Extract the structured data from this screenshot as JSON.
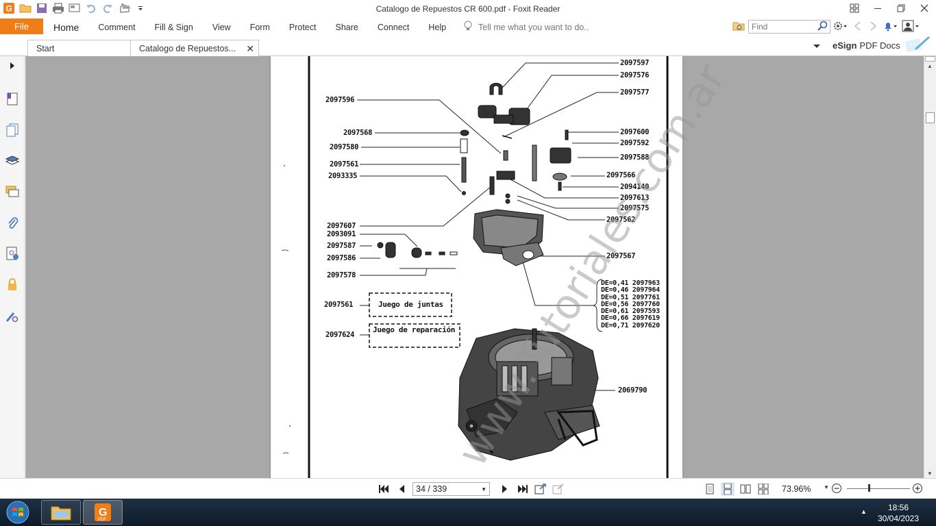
{
  "window": {
    "title": "Catalogo de Repuestos CR 600.pdf - Foxit Reader"
  },
  "ribbon": {
    "file_label": "File",
    "tabs": [
      {
        "label": "Home"
      },
      {
        "label": "Comment"
      },
      {
        "label": "Fill & Sign"
      },
      {
        "label": "View"
      },
      {
        "label": "Form"
      },
      {
        "label": "Protect"
      },
      {
        "label": "Share"
      },
      {
        "label": "Connect"
      },
      {
        "label": "Help"
      }
    ],
    "tell_me_placeholder": "Tell me what you want to do..",
    "find_placeholder": "Find"
  },
  "doc_tabs": {
    "start_label": "Start",
    "doc_label": "Catalogo de Repuestos..."
  },
  "esign": {
    "brand": "eSign",
    "label": "PDF Docs"
  },
  "pdf_page": {
    "watermark": "www.Tutoriales.com.ar",
    "part_numbers_right": [
      "2097597",
      "2097576",
      "2097577",
      "2097600",
      "2097592",
      "2097588",
      "2097566",
      "2094140",
      "2097613",
      "2097575",
      "2097562",
      "2097567",
      "2069790"
    ],
    "part_numbers_left": [
      "2097596",
      "2097568",
      "2097580",
      "2097561",
      "2093335",
      "2097607",
      "2093091",
      "2097587",
      "2097586",
      "2097578",
      "2097561",
      "2097624"
    ],
    "box_juntas": "Juego de juntas",
    "box_reparacion": "Juego de reparación",
    "jets": [
      {
        "de": "DE=0,41",
        "code": "2097963"
      },
      {
        "de": "DE=0,46",
        "code": "2097964"
      },
      {
        "de": "DE=0,51",
        "code": "2097761"
      },
      {
        "de": "DE=0,56",
        "code": "2097760"
      },
      {
        "de": "DE=0,61",
        "code": "2097593"
      },
      {
        "de": "DE=0,66",
        "code": "2097619"
      },
      {
        "de": "DE=0,71",
        "code": "2097620"
      }
    ]
  },
  "statusbar": {
    "page_indicator": "34 / 339",
    "zoom": "73.96%"
  },
  "taskbar": {
    "time": "18:56",
    "date": "30/04/2023"
  },
  "colors": {
    "accent": "#f07d17",
    "viewer_bg": "#a8a8a8",
    "taskbar": "#1a2a3b"
  }
}
